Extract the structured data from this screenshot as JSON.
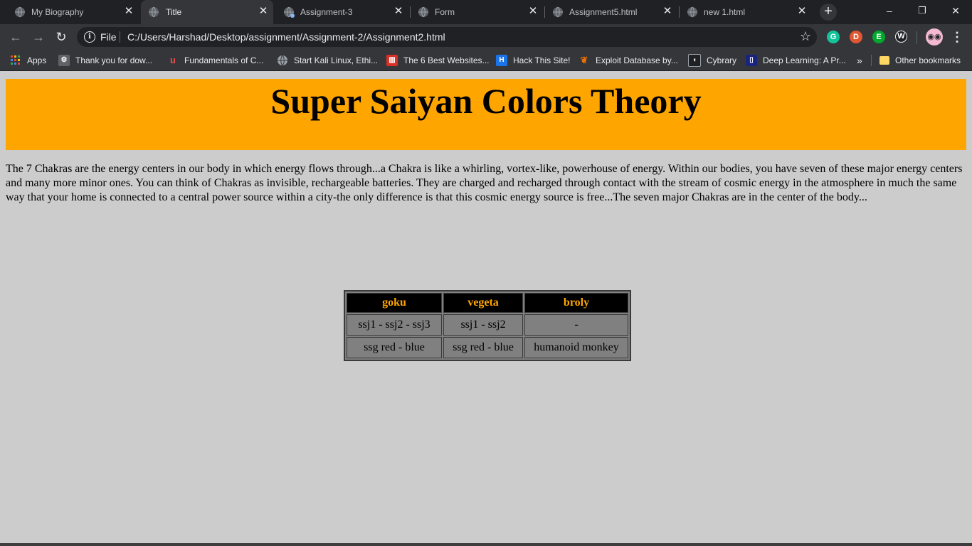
{
  "browser": {
    "tabs": [
      {
        "label": "My Biography",
        "active": false
      },
      {
        "label": "Title",
        "active": true
      },
      {
        "label": "Assignment-3",
        "active": false
      },
      {
        "label": "Form",
        "active": false
      },
      {
        "label": "Assignment5.html",
        "active": false
      },
      {
        "label": "new 1.html",
        "active": false
      }
    ],
    "new_tab": "+",
    "window_controls": {
      "minimize": "–",
      "restore": "❐",
      "close": "✕"
    },
    "address": {
      "scheme_label": "File",
      "url": "C:/Users/Harshad/Desktop/assignment/Assignment-2/Assignment2.html"
    },
    "bookmarks": [
      {
        "label": "Apps",
        "icon": "apps-grid-icon",
        "color": "#e8453c"
      },
      {
        "label": "Thank you for dow...",
        "icon": "gear-icon",
        "color": "#5f6368"
      },
      {
        "label": "Fundamentals of C...",
        "icon": "udemy-icon",
        "color": "#ec5252"
      },
      {
        "label": "Start Kali Linux, Ethi...",
        "icon": "globe-icon",
        "color": "#9aa0a6"
      },
      {
        "label": "The 6 Best Websites...",
        "icon": "book-icon",
        "color": "#d93025"
      },
      {
        "label": "Hack This Site!",
        "icon": "h-icon",
        "color": "#1a73e8"
      },
      {
        "label": "Exploit Database by...",
        "icon": "bug-icon",
        "color": "#e8710a"
      },
      {
        "label": "Cybrary",
        "icon": "cybrary-icon",
        "color": "#202124"
      },
      {
        "label": "Deep Learning: A Pr...",
        "icon": "book-open-icon",
        "color": "#1a237e"
      }
    ],
    "bookmarks_overflow": "»",
    "other_bookmarks": "Other bookmarks"
  },
  "page": {
    "heading": "Super Saiyan Colors Theory",
    "paragraph": "The 7 Chakras are the energy centers in our body in which energy flows through...a Chakra is like a whirling, vortex-like, powerhouse of energy. Within our bodies, you have seven of these major energy centers and many more minor ones. You can think of Chakras as invisible, rechargeable batteries. They are charged and recharged through contact with the stream of cosmic energy in the atmosphere in much the same way that your home is connected to a central power source within a city-the only difference is that this cosmic energy source is free...The seven major Chakras are in the center of the body...",
    "table": {
      "headers": [
        "goku",
        "vegeta",
        "broly"
      ],
      "rows": [
        [
          "ssj1 - ssj2 - ssj3",
          "ssj1 - ssj2",
          "-"
        ],
        [
          "ssg red - blue",
          "ssg red - blue",
          "humanoid monkey"
        ]
      ]
    }
  }
}
